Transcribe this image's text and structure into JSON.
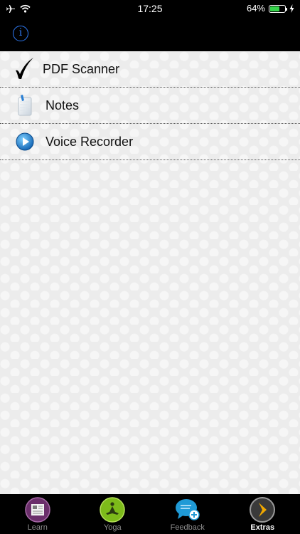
{
  "status_bar": {
    "time": "17:25",
    "battery_percent": "64%",
    "battery_level": 0.64,
    "icons": [
      "airplane-icon",
      "wifi-icon",
      "battery-icon",
      "charging-bolt-icon"
    ]
  },
  "nav_bar": {
    "info_glyph": "i"
  },
  "list": {
    "items": [
      {
        "label": "PDF Scanner",
        "icon": "checkmark-icon"
      },
      {
        "label": "Notes",
        "icon": "notes-icon"
      },
      {
        "label": "Voice Recorder",
        "icon": "play-icon"
      }
    ]
  },
  "tab_bar": {
    "active_tab": "Extras",
    "tabs": [
      {
        "label": "Learn",
        "icon": "book-icon",
        "color": "#6b2f6b"
      },
      {
        "label": "Yoga",
        "icon": "yoga-icon",
        "color": "#7dbb1a"
      },
      {
        "label": "Feedback",
        "icon": "speech-bubble-plus-icon",
        "color": "#1f9ad6"
      },
      {
        "label": "Extras",
        "icon": "chevron-right-icon",
        "color": "#f0a800"
      }
    ]
  },
  "colors": {
    "accent": "#2f7bf6",
    "battery_green": "#35d34a",
    "content_background": "#ececec"
  }
}
